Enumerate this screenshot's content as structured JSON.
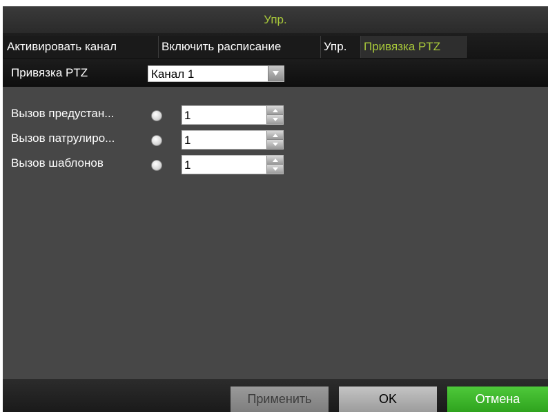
{
  "window": {
    "title": "Упр."
  },
  "tabs": [
    {
      "label": "Активировать канал",
      "active": false
    },
    {
      "label": "Включить расписание",
      "active": false
    },
    {
      "label": "Упр.",
      "active": false
    },
    {
      "label": "Привязка PTZ",
      "active": true
    }
  ],
  "channel": {
    "label": "Привязка PTZ",
    "selected": "Канал 1"
  },
  "ptz_rows": [
    {
      "label": "Вызов предустан...",
      "value": "1",
      "selected": false
    },
    {
      "label": "Вызов патрулиро...",
      "value": "1",
      "selected": false
    },
    {
      "label": "Вызов шаблонов",
      "value": "1",
      "selected": false
    }
  ],
  "buttons": {
    "apply": "Применить",
    "ok": "OK",
    "cancel": "Отмена"
  },
  "icons": {
    "dropdown": "chevron-down-icon",
    "spin_up": "arrow-up-icon",
    "spin_down": "arrow-down-icon",
    "radio": "radio-icon"
  },
  "colors": {
    "accent": "#a8c83a",
    "cancel_button": "#3bb52a",
    "panel": "#474747"
  }
}
